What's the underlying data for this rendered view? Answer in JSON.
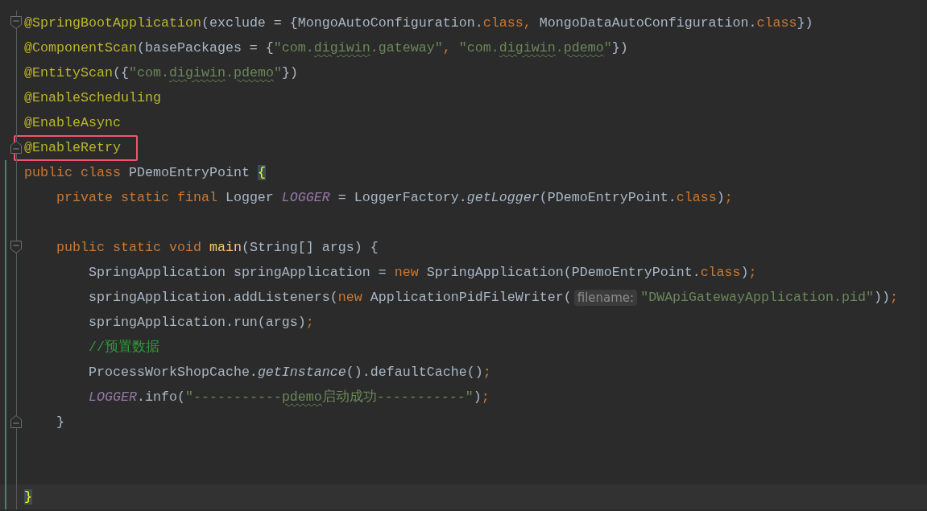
{
  "editor": {
    "lines": [
      {
        "kind": "line",
        "gutter": [
          {
            "kind": "fold_start"
          }
        ],
        "segments": [
          {
            "kind": "code",
            "tokens": [
              {
                "kind": "annotation",
                "text": "@SpringBootApplication"
              },
              {
                "kind": "plain",
                "text": "(exclude = {MongoAutoConfiguration."
              },
              {
                "kind": "keyword",
                "text": "class, "
              },
              {
                "kind": "plain",
                "text": "MongoDataAutoConfiguration."
              },
              {
                "kind": "keyword",
                "text": "class"
              },
              {
                "kind": "plain",
                "text": "})"
              }
            ]
          }
        ]
      },
      {
        "kind": "line",
        "segments": [
          {
            "kind": "code",
            "tokens": [
              {
                "kind": "annotation",
                "text": "@ComponentScan"
              },
              {
                "kind": "plain",
                "text": "(basePackages = {"
              },
              {
                "kind": "string",
                "text": "\"com."
              },
              {
                "kind": "string_typo",
                "text": "digiwin"
              },
              {
                "kind": "string",
                "text": ".gateway\""
              },
              {
                "kind": "keyword",
                "text": ", "
              },
              {
                "kind": "string",
                "text": "\"com."
              },
              {
                "kind": "string_typo",
                "text": "digiwin"
              },
              {
                "kind": "string",
                "text": "."
              },
              {
                "kind": "string_typo",
                "text": "pdemo"
              },
              {
                "kind": "string",
                "text": "\""
              },
              {
                "kind": "plain",
                "text": "})"
              }
            ]
          }
        ]
      },
      {
        "kind": "line",
        "segments": [
          {
            "kind": "code",
            "tokens": [
              {
                "kind": "annotation",
                "text": "@EntityScan"
              },
              {
                "kind": "plain",
                "text": "({"
              },
              {
                "kind": "string",
                "text": "\"com."
              },
              {
                "kind": "string_typo",
                "text": "digiwin"
              },
              {
                "kind": "string",
                "text": "."
              },
              {
                "kind": "string_typo",
                "text": "pdemo"
              },
              {
                "kind": "string",
                "text": "\""
              },
              {
                "kind": "plain",
                "text": "})"
              }
            ]
          }
        ]
      },
      {
        "kind": "line",
        "segments": [
          {
            "kind": "code",
            "tokens": [
              {
                "kind": "annotation",
                "text": "@EnableScheduling"
              }
            ]
          }
        ]
      },
      {
        "kind": "line",
        "segments": [
          {
            "kind": "code",
            "tokens": [
              {
                "kind": "annotation",
                "text": "@EnableAsync"
              }
            ]
          }
        ]
      },
      {
        "kind": "line",
        "gutter": [
          {
            "kind": "fold_end"
          }
        ],
        "segments": [
          {
            "kind": "code_boxed",
            "tokens": [
              {
                "kind": "annotation",
                "text": "@EnableRetry"
              }
            ]
          }
        ]
      },
      {
        "kind": "line",
        "gutter": [
          {
            "kind": "change"
          }
        ],
        "segments": [
          {
            "kind": "code",
            "tokens": [
              {
                "kind": "keyword",
                "text": "public class "
              },
              {
                "kind": "plain",
                "text": "PDemoEntryPoint "
              },
              {
                "kind": "brace_match",
                "text": "{"
              }
            ]
          }
        ]
      },
      {
        "kind": "line",
        "gutter": [
          {
            "kind": "change"
          }
        ],
        "segments": [
          {
            "kind": "code",
            "tokens": [
              {
                "kind": "keyword",
                "text": "    private static final "
              },
              {
                "kind": "plain",
                "text": "Logger "
              },
              {
                "kind": "constant",
                "text": "LOGGER"
              },
              {
                "kind": "plain",
                "text": " = LoggerFactory."
              },
              {
                "kind": "static_call",
                "text": "getLogger"
              },
              {
                "kind": "plain",
                "text": "(PDemoEntryPoint."
              },
              {
                "kind": "keyword",
                "text": "class"
              },
              {
                "kind": "plain",
                "text": ")"
              },
              {
                "kind": "keyword",
                "text": ";"
              }
            ]
          }
        ]
      },
      {
        "kind": "line",
        "gutter": [
          {
            "kind": "change"
          }
        ]
      },
      {
        "kind": "line",
        "gutter": [
          {
            "kind": "change"
          },
          {
            "kind": "fold_start"
          }
        ],
        "segments": [
          {
            "kind": "code",
            "tokens": [
              {
                "kind": "keyword",
                "text": "    public static void "
              },
              {
                "kind": "method_decl",
                "text": "main"
              },
              {
                "kind": "plain",
                "text": "(String[] args) {"
              }
            ]
          }
        ]
      },
      {
        "kind": "line",
        "gutter": [
          {
            "kind": "change"
          }
        ],
        "segments": [
          {
            "kind": "code",
            "tokens": [
              {
                "kind": "plain",
                "text": "        SpringApplication springApplication = "
              },
              {
                "kind": "keyword",
                "text": "new "
              },
              {
                "kind": "plain",
                "text": "SpringApplication(PDemoEntryPoint."
              },
              {
                "kind": "keyword",
                "text": "class"
              },
              {
                "kind": "plain",
                "text": ")"
              },
              {
                "kind": "keyword",
                "text": ";"
              }
            ]
          }
        ]
      },
      {
        "kind": "line",
        "gutter": [
          {
            "kind": "change"
          }
        ],
        "segments": [
          {
            "kind": "code",
            "tokens": [
              {
                "kind": "plain",
                "text": "        springApplication.addListeners("
              },
              {
                "kind": "keyword",
                "text": "new "
              },
              {
                "kind": "plain",
                "text": "ApplicationPidFileWriter("
              }
            ]
          },
          {
            "kind": "hint",
            "text": "filename:"
          },
          {
            "kind": "code",
            "tokens": [
              {
                "kind": "string",
                "text": "\"DWApiGatewayApplication.pid\""
              },
              {
                "kind": "plain",
                "text": "))"
              },
              {
                "kind": "keyword",
                "text": ";"
              }
            ]
          }
        ]
      },
      {
        "kind": "line",
        "gutter": [
          {
            "kind": "change"
          }
        ],
        "segments": [
          {
            "kind": "code",
            "tokens": [
              {
                "kind": "plain",
                "text": "        springApplication.run(args)"
              },
              {
                "kind": "keyword",
                "text": ";"
              }
            ]
          }
        ]
      },
      {
        "kind": "line",
        "gutter": [
          {
            "kind": "change"
          }
        ],
        "segments": [
          {
            "kind": "code",
            "tokens": [
              {
                "kind": "comment",
                "text": "        //预置数据"
              }
            ]
          }
        ]
      },
      {
        "kind": "line",
        "gutter": [
          {
            "kind": "change"
          }
        ],
        "segments": [
          {
            "kind": "code",
            "tokens": [
              {
                "kind": "plain",
                "text": "        ProcessWorkShopCache."
              },
              {
                "kind": "static_call",
                "text": "getInstance"
              },
              {
                "kind": "plain",
                "text": "().defaultCache()"
              },
              {
                "kind": "keyword",
                "text": ";"
              }
            ]
          }
        ]
      },
      {
        "kind": "line",
        "gutter": [
          {
            "kind": "change"
          }
        ],
        "segments": [
          {
            "kind": "code",
            "tokens": [
              {
                "kind": "constant",
                "text": "        LOGGER"
              },
              {
                "kind": "plain",
                "text": ".info("
              },
              {
                "kind": "string",
                "text": "\"-----------"
              },
              {
                "kind": "string_typo",
                "text": "pdemo"
              },
              {
                "kind": "string",
                "text": "启动成功-----------\""
              },
              {
                "kind": "plain",
                "text": ")"
              },
              {
                "kind": "keyword",
                "text": ";"
              }
            ]
          }
        ]
      },
      {
        "kind": "line",
        "gutter": [
          {
            "kind": "change"
          },
          {
            "kind": "fold_end"
          }
        ],
        "segments": [
          {
            "kind": "code",
            "tokens": [
              {
                "kind": "plain",
                "text": "    }"
              }
            ]
          }
        ]
      },
      {
        "kind": "line",
        "gutter": [
          {
            "kind": "change"
          }
        ]
      },
      {
        "kind": "line",
        "gutter": [
          {
            "kind": "change"
          }
        ]
      },
      {
        "kind": "current",
        "gutter": [
          {
            "kind": "change"
          }
        ],
        "segments": [
          {
            "kind": "code",
            "tokens": [
              {
                "kind": "brace_match",
                "text": "}"
              }
            ]
          }
        ]
      }
    ]
  }
}
